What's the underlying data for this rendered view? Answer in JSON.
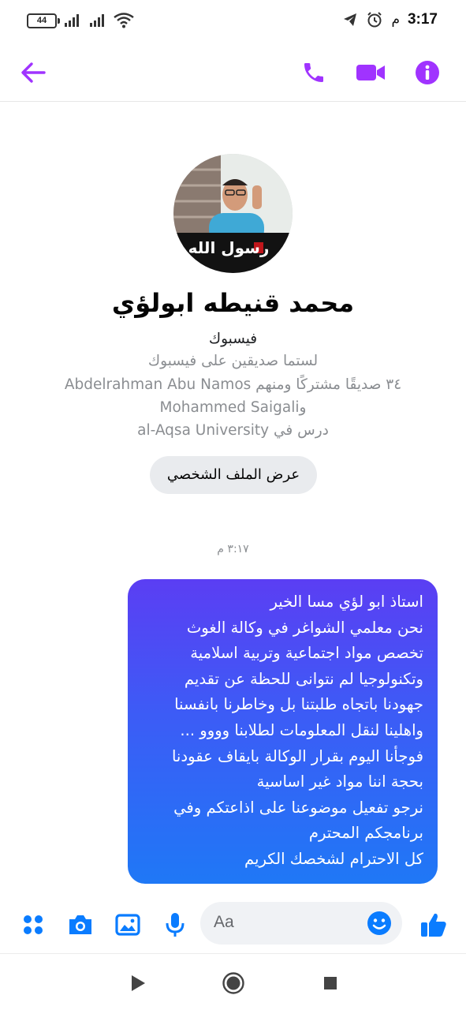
{
  "status_bar": {
    "battery": "44",
    "time": "3:17",
    "time_suffix": "م"
  },
  "header": {
    "back_icon": "arrow-left-icon",
    "call_icon": "phone-icon",
    "video_icon": "video-camera-icon",
    "info_icon": "info-icon",
    "accent_color": "#a033ff"
  },
  "profile": {
    "avatar_caption": "رسول الله",
    "name": "محمد قنيطه ابولؤي",
    "source": "فيسبوك",
    "friend_status": "لستما صديقين على فيسبوك",
    "mutual_friends": "٣٤ صديقًا مشتركًا ومنهم Abdelrahman Abu Namos",
    "mutual_friends_more": "وMohammed Saigali",
    "education": "درس في al-Aqsa University",
    "view_profile_label": "عرض الملف الشخصي"
  },
  "conversation": {
    "timestamp": "٣:١٧ م",
    "message_lines": [
      "استاذ ابو لؤي مسا الخير",
      "نحن معلمي الشواغر في وكالة الغوث",
      "تخصص مواد اجتماعية وتربية اسلامية",
      "وتكنولوجيا لم نتوانى للحظة عن تقديم",
      "جهودنا باتجاه طلبتنا بل وخاطرنا بانفسنا",
      "واهلينا لنقل المعلومات لطلابنا وووو ...",
      "فوجأنا اليوم بقرار الوكالة بايقاف عقودنا",
      "بحجة اننا مواد غير اساسية",
      "نرجو تفعيل موضوعنا على اذاعتكم وفي",
      "برنامجكم المحترم",
      "كل الاحترام لشخصك الكريم"
    ]
  },
  "composer": {
    "placeholder": "Aa",
    "icons": [
      "apps-grid-icon",
      "camera-icon",
      "gallery-icon",
      "microphone-icon",
      "emoji-icon",
      "thumbs-up-icon"
    ],
    "icon_color": "#0a7cff"
  },
  "nav_bar": {
    "icons": [
      "back-triangle-icon",
      "home-circle-icon",
      "recents-square-icon"
    ]
  }
}
